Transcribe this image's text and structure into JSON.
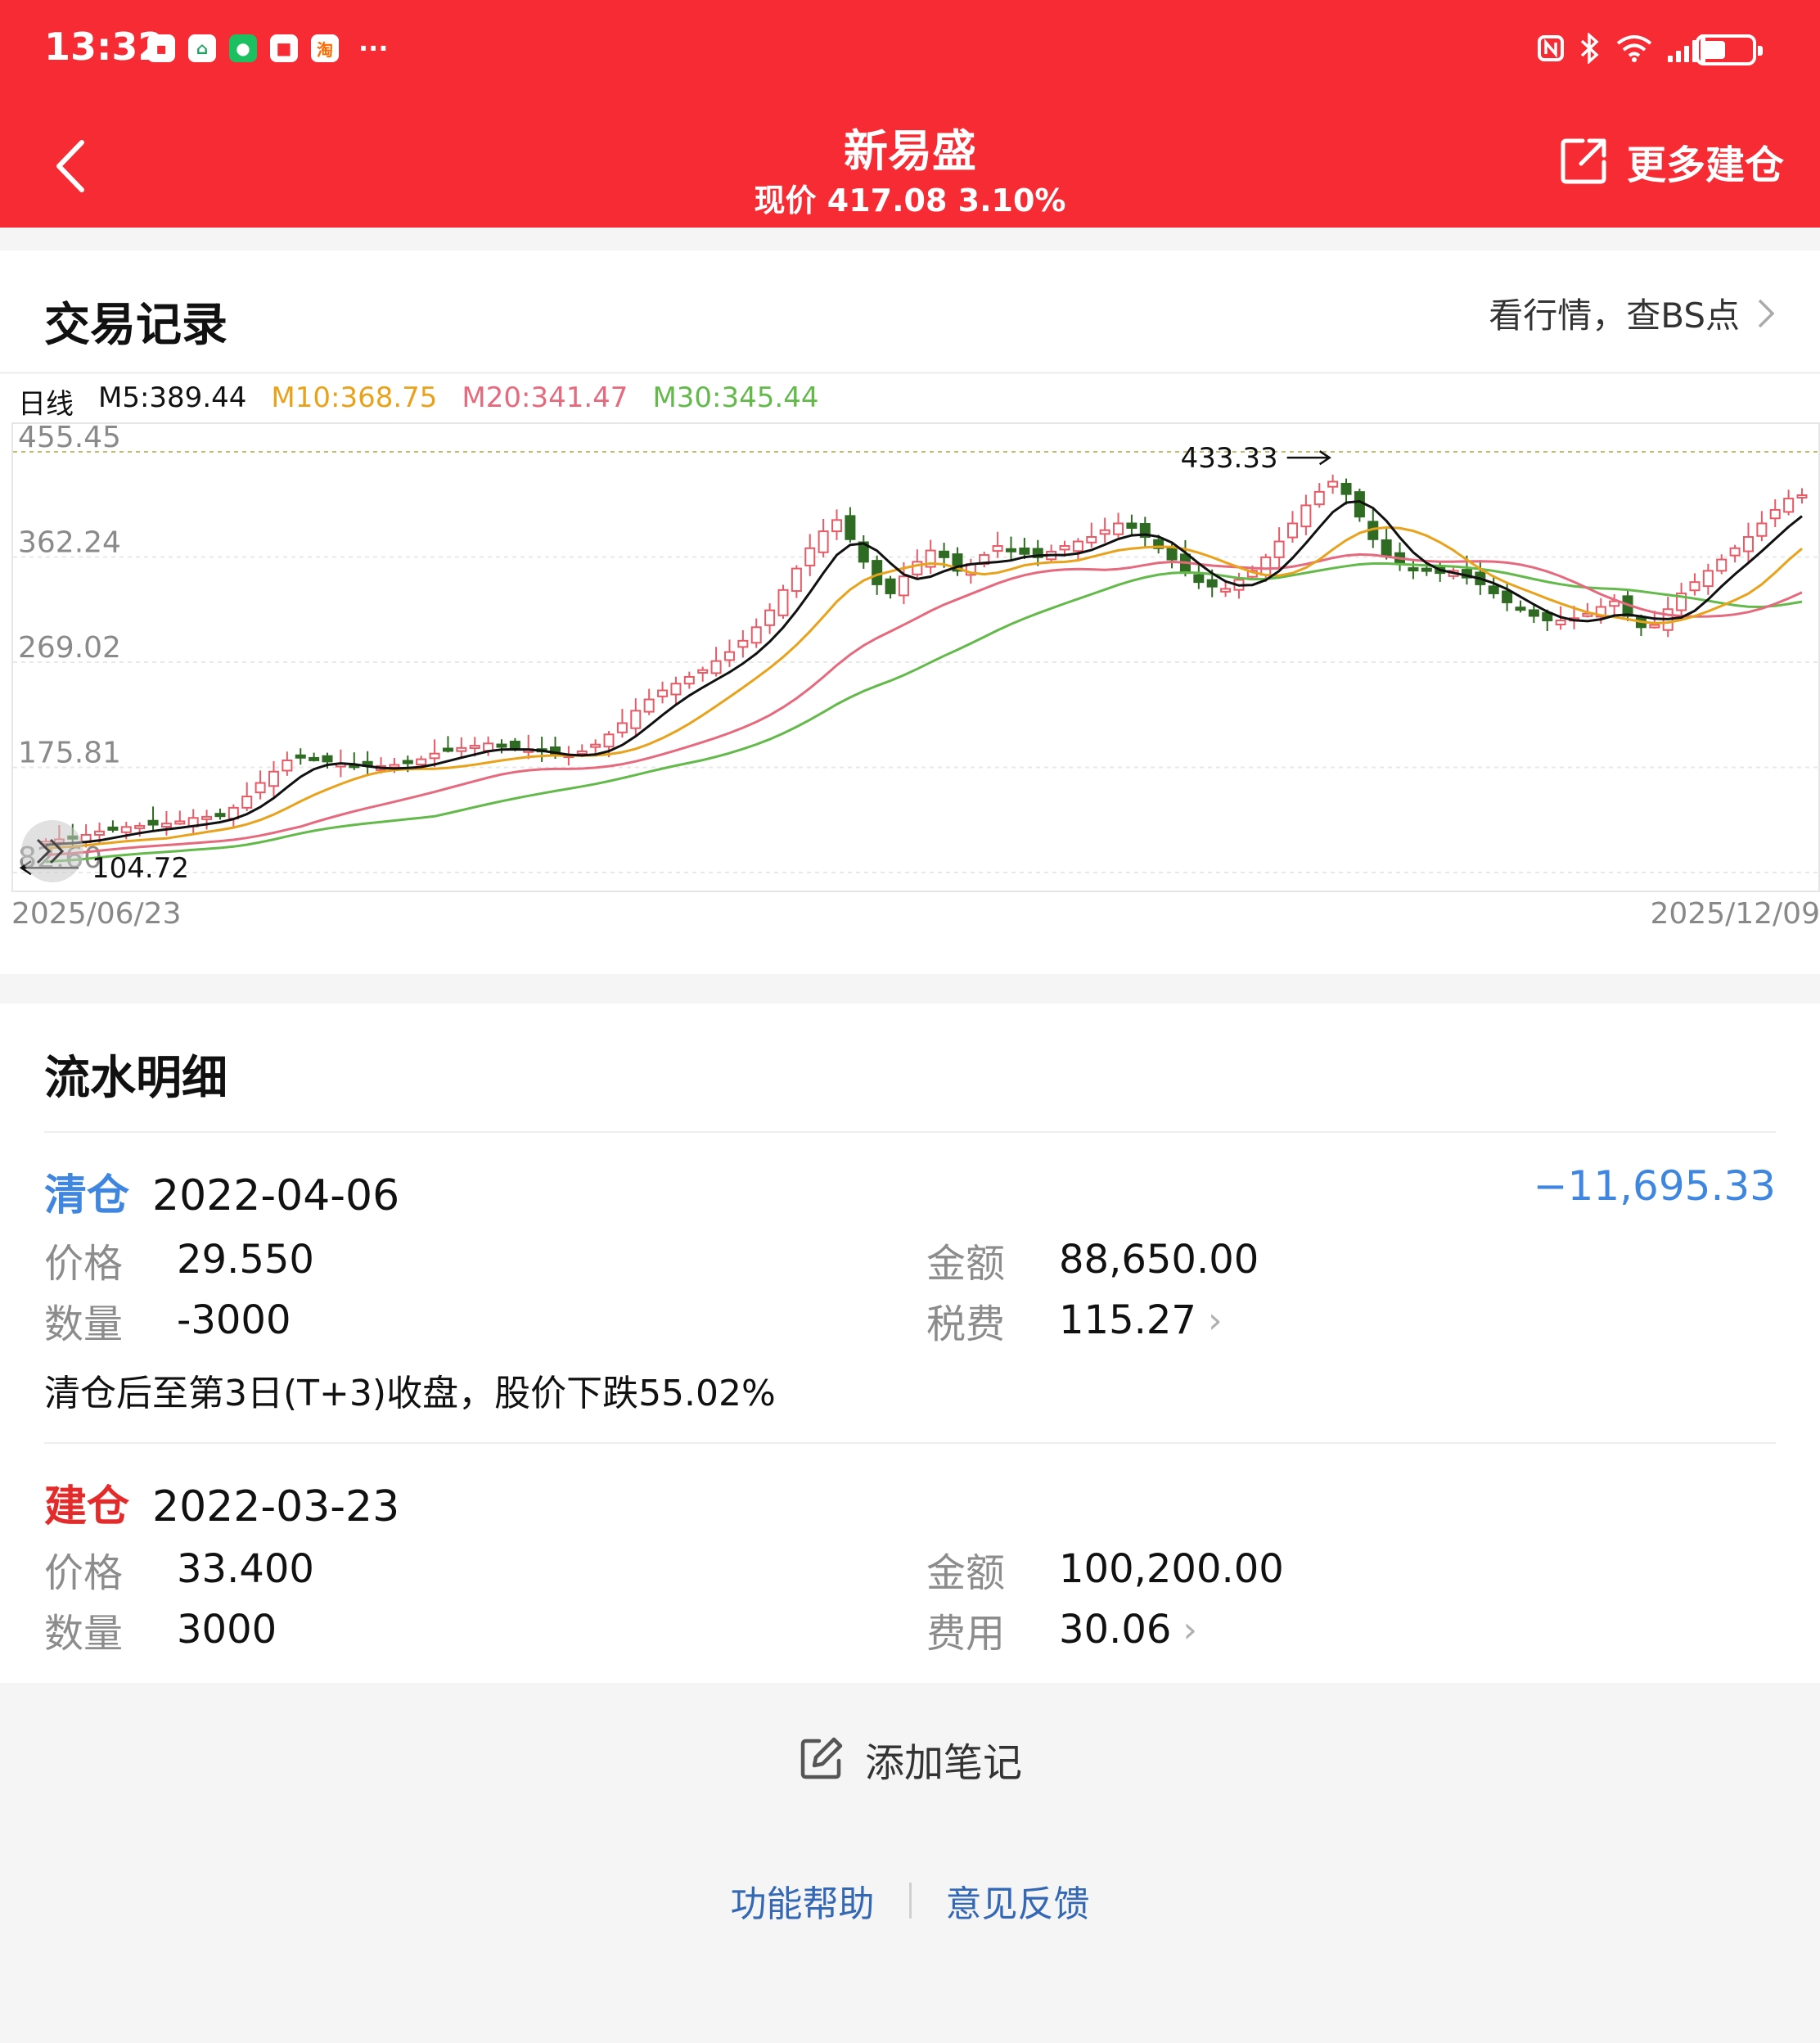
{
  "status_bar": {
    "time": "13:32",
    "overflow": "···"
  },
  "header": {
    "title": "新易盛",
    "subtitle": "现价 417.08 3.10%",
    "more_label": "更多建仓",
    "color": "#f62b34"
  },
  "trade_record": {
    "title": "交易记录",
    "link_label": "看行情，查BS点",
    "ma": {
      "period": "日线",
      "m5": "M5:389.44",
      "m10": "M10:368.75",
      "m20": "M20:341.47",
      "m30": "M30:345.44",
      "colors": {
        "m5": "#111111",
        "m10": "#e8a21b",
        "m20": "#e56a7d",
        "m30": "#63b94a"
      }
    }
  },
  "chart_data": {
    "type": "candlestick",
    "y_ticks": [
      "455.45",
      "362.24",
      "269.02",
      "175.81",
      "82.60"
    ],
    "ylim": [
      82.6,
      455.45
    ],
    "x_start": "2025/06/23",
    "x_end": "2025/12/09",
    "high_label": "433.33",
    "low_label": "104.72",
    "up_color": "#e85a66",
    "down_color": "#2f6b22",
    "close_series": [
      110,
      112,
      113,
      116,
      119,
      121,
      123,
      124,
      125,
      126,
      128,
      131,
      132,
      134,
      140,
      150,
      162,
      172,
      182,
      186,
      184,
      181,
      179,
      178,
      177,
      177,
      178,
      181,
      183,
      188,
      192,
      193,
      195,
      197,
      196,
      193,
      192,
      190,
      188,
      187,
      190,
      196,
      205,
      215,
      226,
      236,
      244,
      250,
      256,
      262,
      270,
      278,
      288,
      300,
      315,
      333,
      352,
      370,
      385,
      395,
      378,
      358,
      338,
      330,
      345,
      358,
      368,
      362,
      350,
      356,
      364,
      372,
      369,
      365,
      362,
      367,
      372,
      376,
      380,
      386,
      392,
      388,
      380,
      370,
      360,
      348,
      340,
      336,
      334,
      342,
      350,
      362,
      376,
      392,
      408,
      420,
      429,
      418,
      398,
      378,
      363,
      356,
      352,
      350,
      348,
      350,
      344,
      338,
      330,
      322,
      316,
      310,
      306,
      306,
      308,
      312,
      318,
      323,
      310,
      300,
      302,
      316,
      330,
      340,
      350,
      360,
      370,
      380,
      392,
      404,
      414,
      417
    ]
  },
  "flow": {
    "title": "流水明细",
    "trades": [
      {
        "type": "清仓",
        "date": "2022-04-06",
        "pnl": "−11,695.33",
        "price_label": "价格",
        "price": "29.550",
        "qty_label": "数量",
        "qty": "-3000",
        "amount_label": "金额",
        "amount": "88,650.00",
        "fee_label": "税费",
        "fee": "115.27",
        "note": "清仓后至第3日(T+3)收盘，股价下跌55.02%",
        "type_color": "#3f86e0"
      },
      {
        "type": "建仓",
        "date": "2022-03-23",
        "price_label": "价格",
        "price": "33.400",
        "qty_label": "数量",
        "qty": "3000",
        "amount_label": "金额",
        "amount": "100,200.00",
        "fee_label": "费用",
        "fee": "30.06",
        "type_color": "#e42b2b"
      }
    ]
  },
  "bottom": {
    "add_note": "添加笔记",
    "help": "功能帮助",
    "feedback": "意见反馈"
  }
}
